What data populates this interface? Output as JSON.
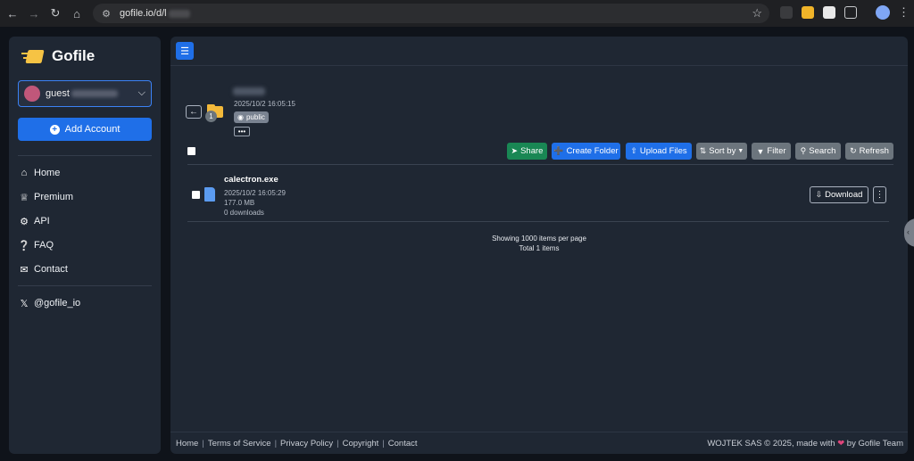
{
  "browser": {
    "url": "gofile.io/d/l",
    "icons": [
      "back-arrow",
      "forward-arrow",
      "reload",
      "home",
      "site-settings",
      "bookmark-star",
      "extensions",
      "profile",
      "menu"
    ]
  },
  "sidebar": {
    "logo_text": "Gofile",
    "account_name": "guest",
    "add_account_label": "Add Account",
    "nav": [
      {
        "label": "Home",
        "icon": "home-icon"
      },
      {
        "label": "Premium",
        "icon": "crown-icon"
      },
      {
        "label": "API",
        "icon": "gears-icon"
      },
      {
        "label": "FAQ",
        "icon": "question-icon"
      },
      {
        "label": "Contact",
        "icon": "envelope-icon"
      }
    ],
    "social": {
      "label": "@gofile_io",
      "icon": "x-icon"
    }
  },
  "folder": {
    "date": "2025/10/2 16:05:15",
    "visibility": "public",
    "item_count": "1",
    "more_label": "•••"
  },
  "toolbar": {
    "share": "Share",
    "create_folder": "Create Folder",
    "upload_files": "Upload Files",
    "sort_by": "Sort by",
    "filter": "Filter",
    "search": "Search",
    "refresh": "Refresh"
  },
  "files": [
    {
      "name": "calectron.exe",
      "date": "2025/10/2 16:05:29",
      "size": "177.0 MB",
      "downloads": "0 downloads",
      "download_label": "Download"
    }
  ],
  "pagination": {
    "per_page": "Showing 1000 items per page",
    "total": "Total 1 items"
  },
  "footer": {
    "links": [
      "Home",
      "Terms of Service",
      "Privacy Policy",
      "Copyright",
      "Contact"
    ],
    "right_prefix": "WOJTEK SAS © 2025, made with",
    "right_suffix": "by Gofile Team"
  },
  "colors": {
    "accent": "#1f6fe8",
    "share": "#198754",
    "secondary": "#6c757d",
    "panel": "#1f2733",
    "background": "#0f131a"
  }
}
